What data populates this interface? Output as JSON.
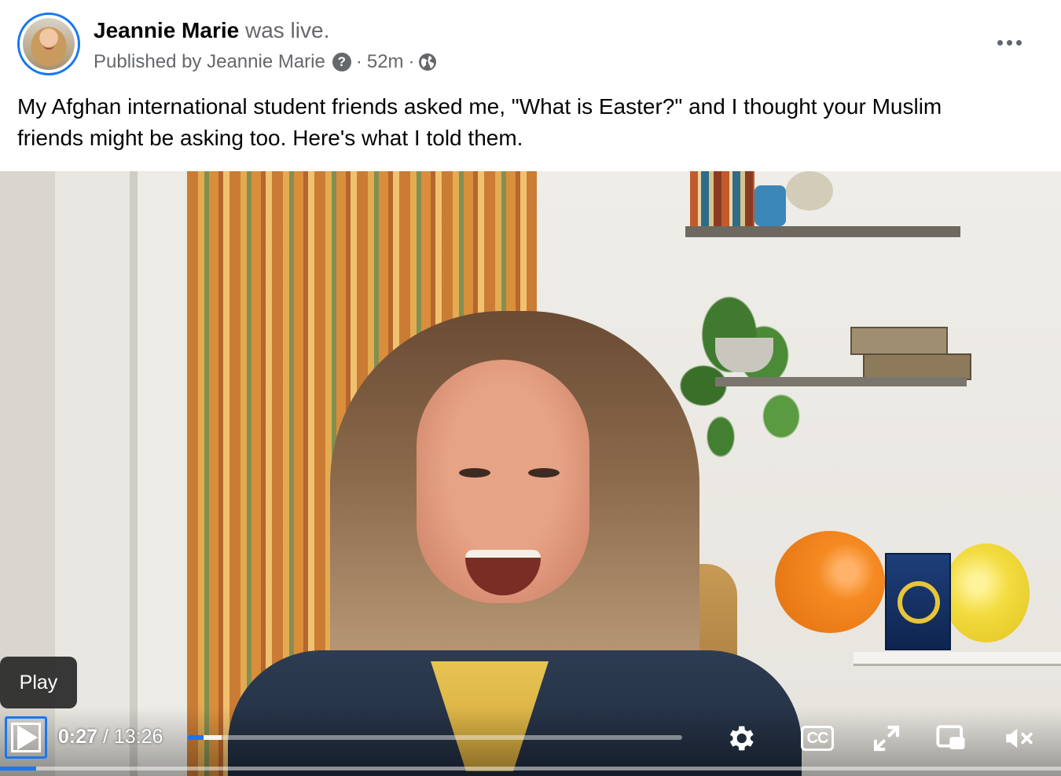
{
  "post": {
    "author": "Jeannie Marie",
    "status": "was live.",
    "published_by": "Published by Jeannie Marie",
    "help_symbol": "?",
    "separator": "·",
    "time_ago": "52m",
    "audience_icon": "globe-icon",
    "more_icon": "more-options-icon",
    "text": "My Afghan international student friends asked me, \"What is Easter?\" and I thought your Muslim friends might be asking too. Here's what I told them."
  },
  "video": {
    "tooltip": "Play",
    "current_time": "0:27",
    "time_separator": " / ",
    "duration": "13:26",
    "progress_fraction": 0.034,
    "buffered_fraction": 0.07,
    "controls": {
      "play_icon": "play-icon",
      "settings_icon": "gear-icon",
      "captions_label": "CC",
      "fullscreen_icon": "fullscreen-icon",
      "pip_icon": "picture-in-picture-icon",
      "mute_icon": "muted-volume-icon"
    },
    "accent_color": "#1877f2"
  }
}
